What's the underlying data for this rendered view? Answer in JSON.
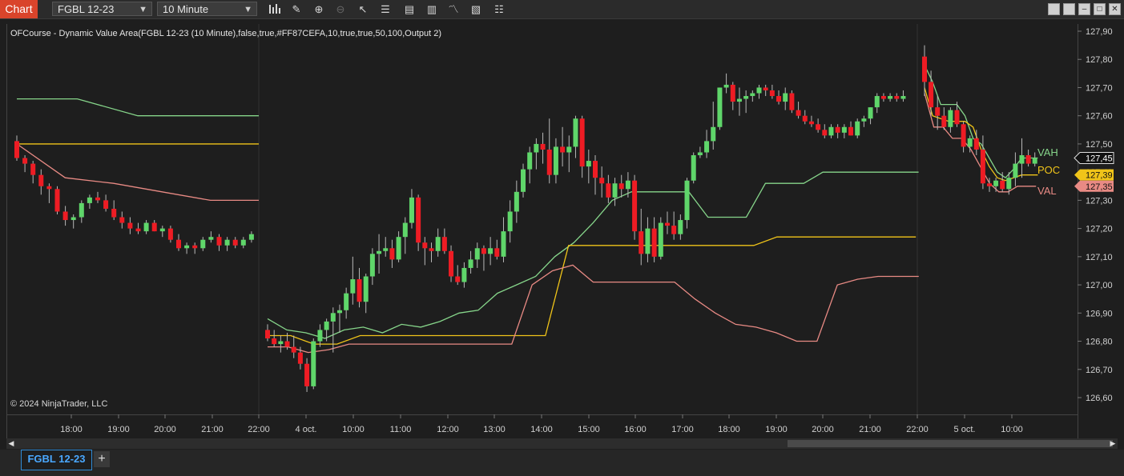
{
  "title_tag": "Chart",
  "instrument": "FGBL 12-23",
  "interval": "10 Minute",
  "indicator_label": "OFCourse - Dynamic Value Area(FGBL 12-23 (10 Minute),false,true,#FF87CEFA,10,true,true,50,100,Output 2)",
  "copyright": "© 2024 NinjaTrader, LLC",
  "tab_label": "FGBL 12-23",
  "add_tab": "+",
  "colors": {
    "up": "#5fd66a",
    "down": "#ee1c24",
    "vah": "#86d58a",
    "poc": "#f0c419",
    "val": "#e88a84",
    "axis_text": "#d0d0d0"
  },
  "chart_data": {
    "type": "candlestick",
    "y_ticks": [
      "127,90",
      "127,80",
      "127,70",
      "127,60",
      "127,50",
      "127,40",
      "127,30",
      "127,20",
      "127,10",
      "127,00",
      "126,90",
      "126,80",
      "126,70",
      "126,60"
    ],
    "ylim": [
      126.56,
      127.93
    ],
    "x_ticks": [
      "18:00",
      "19:00",
      "20:00",
      "21:00",
      "22:00",
      "4 oct.",
      "10:00",
      "11:00",
      "12:00",
      "13:00",
      "14:00",
      "15:00",
      "16:00",
      "17:00",
      "18:00",
      "19:00",
      "20:00",
      "21:00",
      "22:00",
      "5 oct.",
      "10:00"
    ],
    "price_labels": [
      {
        "text": "127,45",
        "value": 127.45,
        "kind": "last"
      },
      {
        "text": "127,39",
        "value": 127.39,
        "kind": "poc"
      },
      {
        "text": "127,35",
        "value": 127.35,
        "kind": "val"
      }
    ],
    "line_labels": [
      {
        "text": "VAH",
        "kind": "vah"
      },
      {
        "text": "POC",
        "kind": "poc"
      },
      {
        "text": "VAL",
        "kind": "val"
      }
    ],
    "session1": {
      "candles": [
        [
          127.51,
          127.53,
          127.44,
          127.45
        ],
        [
          127.45,
          127.46,
          127.4,
          127.43
        ],
        [
          127.43,
          127.44,
          127.36,
          127.39
        ],
        [
          127.39,
          127.41,
          127.32,
          127.35
        ],
        [
          127.35,
          127.36,
          127.29,
          127.34
        ],
        [
          127.34,
          127.35,
          127.25,
          127.26
        ],
        [
          127.26,
          127.28,
          127.21,
          127.23
        ],
        [
          127.23,
          127.25,
          127.2,
          127.24
        ],
        [
          127.24,
          127.3,
          127.22,
          127.29
        ],
        [
          127.29,
          127.32,
          127.27,
          127.31
        ],
        [
          127.31,
          127.33,
          127.29,
          127.3
        ],
        [
          127.3,
          127.32,
          127.26,
          127.27
        ],
        [
          127.27,
          127.3,
          127.23,
          127.24
        ],
        [
          127.24,
          127.26,
          127.2,
          127.22
        ],
        [
          127.22,
          127.24,
          127.18,
          127.2
        ],
        [
          127.2,
          127.22,
          127.18,
          127.19
        ],
        [
          127.19,
          127.23,
          127.18,
          127.22
        ],
        [
          127.22,
          127.23,
          127.19,
          127.19
        ],
        [
          127.19,
          127.21,
          127.17,
          127.2
        ],
        [
          127.2,
          127.21,
          127.15,
          127.16
        ],
        [
          127.16,
          127.18,
          127.12,
          127.13
        ],
        [
          127.13,
          127.15,
          127.11,
          127.14
        ],
        [
          127.14,
          127.15,
          127.11,
          127.13
        ],
        [
          127.13,
          127.17,
          127.12,
          127.16
        ],
        [
          127.16,
          127.19,
          127.15,
          127.17
        ],
        [
          127.17,
          127.18,
          127.12,
          127.14
        ],
        [
          127.14,
          127.17,
          127.12,
          127.16
        ],
        [
          127.16,
          127.17,
          127.13,
          127.14
        ],
        [
          127.14,
          127.17,
          127.13,
          127.16
        ],
        [
          127.16,
          127.19,
          127.15,
          127.18
        ]
      ],
      "vah": [
        127.66,
        127.66,
        127.6,
        127.6,
        127.6
      ],
      "poc": [
        127.5,
        127.5,
        127.5
      ],
      "val": [
        127.5,
        127.38,
        127.36,
        127.33,
        127.3,
        127.3
      ]
    },
    "session2": {
      "candles": [
        [
          126.84,
          126.86,
          126.8,
          126.81
        ],
        [
          126.81,
          126.84,
          126.78,
          126.79
        ],
        [
          126.79,
          126.82,
          126.76,
          126.8
        ],
        [
          126.8,
          126.83,
          126.77,
          126.78
        ],
        [
          126.78,
          126.82,
          126.74,
          126.76
        ],
        [
          126.76,
          126.78,
          126.7,
          126.72
        ],
        [
          126.72,
          126.74,
          126.62,
          126.64
        ],
        [
          126.64,
          126.81,
          126.63,
          126.8
        ],
        [
          126.8,
          126.86,
          126.78,
          126.84
        ],
        [
          126.84,
          126.88,
          126.8,
          126.87
        ],
        [
          126.87,
          126.92,
          126.76,
          126.9
        ],
        [
          126.9,
          126.93,
          126.83,
          126.91
        ],
        [
          126.91,
          126.99,
          126.88,
          126.97
        ],
        [
          126.97,
          127.1,
          126.93,
          127.02
        ],
        [
          127.02,
          127.06,
          126.92,
          126.94
        ],
        [
          126.94,
          127.04,
          126.9,
          127.03
        ],
        [
          127.03,
          127.13,
          127.0,
          127.11
        ],
        [
          127.11,
          127.18,
          127.04,
          127.12
        ],
        [
          127.12,
          127.17,
          127.1,
          127.13
        ],
        [
          127.13,
          127.16,
          127.06,
          127.09
        ],
        [
          127.09,
          127.19,
          127.08,
          127.17
        ],
        [
          127.17,
          127.24,
          127.11,
          127.22
        ],
        [
          127.22,
          127.34,
          127.2,
          127.31
        ],
        [
          127.31,
          127.32,
          127.12,
          127.15
        ],
        [
          127.15,
          127.17,
          127.07,
          127.13
        ],
        [
          127.13,
          127.15,
          127.08,
          127.12
        ],
        [
          127.12,
          127.2,
          127.1,
          127.17
        ],
        [
          127.17,
          127.2,
          127.11,
          127.12
        ],
        [
          127.12,
          127.14,
          127.01,
          127.03
        ],
        [
          127.03,
          127.07,
          127.0,
          127.01
        ],
        [
          127.01,
          127.08,
          126.99,
          127.06
        ],
        [
          127.06,
          127.12,
          127.04,
          127.09
        ],
        [
          127.09,
          127.15,
          127.06,
          127.13
        ],
        [
          127.13,
          127.14,
          127.05,
          127.11
        ],
        [
          127.11,
          127.17,
          127.07,
          127.13
        ],
        [
          127.13,
          127.16,
          127.09,
          127.1
        ],
        [
          127.1,
          127.24,
          127.08,
          127.19
        ],
        [
          127.19,
          127.3,
          127.15,
          127.26
        ],
        [
          127.26,
          127.37,
          127.22,
          127.33
        ],
        [
          127.33,
          127.43,
          127.31,
          127.41
        ],
        [
          127.41,
          127.49,
          127.36,
          127.47
        ],
        [
          127.47,
          127.52,
          127.41,
          127.5
        ],
        [
          127.5,
          127.54,
          127.43,
          127.48
        ],
        [
          127.48,
          127.59,
          127.36,
          127.39
        ],
        [
          127.39,
          127.52,
          127.36,
          127.49
        ],
        [
          127.49,
          127.56,
          127.42,
          127.47
        ],
        [
          127.47,
          127.53,
          127.4,
          127.49
        ],
        [
          127.49,
          127.6,
          127.45,
          127.59
        ],
        [
          127.59,
          127.6,
          127.38,
          127.42
        ],
        [
          127.42,
          127.48,
          127.36,
          127.44
        ],
        [
          127.44,
          127.46,
          127.32,
          127.38
        ],
        [
          127.38,
          127.42,
          127.31,
          127.36
        ],
        [
          127.36,
          127.39,
          127.29,
          127.31
        ],
        [
          127.31,
          127.38,
          127.28,
          127.36
        ],
        [
          127.36,
          127.39,
          127.31,
          127.34
        ],
        [
          127.34,
          127.4,
          127.31,
          127.37
        ],
        [
          127.37,
          127.39,
          127.16,
          127.19
        ],
        [
          127.19,
          127.27,
          127.07,
          127.11
        ],
        [
          127.11,
          127.24,
          127.08,
          127.2
        ],
        [
          127.2,
          127.24,
          127.08,
          127.1
        ],
        [
          127.1,
          127.24,
          127.09,
          127.22
        ],
        [
          127.22,
          127.26,
          127.18,
          127.21
        ],
        [
          127.21,
          127.26,
          127.16,
          127.18
        ],
        [
          127.18,
          127.25,
          127.16,
          127.23
        ],
        [
          127.23,
          127.38,
          127.2,
          127.37
        ],
        [
          127.37,
          127.47,
          127.36,
          127.46
        ],
        [
          127.46,
          127.49,
          127.45,
          127.47
        ],
        [
          127.47,
          127.55,
          127.45,
          127.51
        ],
        [
          127.51,
          127.65,
          127.48,
          127.56
        ],
        [
          127.56,
          127.7,
          127.55,
          127.7
        ],
        [
          127.7,
          127.75,
          127.68,
          127.71
        ],
        [
          127.71,
          127.72,
          127.62,
          127.65
        ],
        [
          127.65,
          127.7,
          127.6,
          127.66
        ],
        [
          127.66,
          127.69,
          127.61,
          127.67
        ],
        [
          127.67,
          127.69,
          127.65,
          127.68
        ],
        [
          127.68,
          127.71,
          127.66,
          127.7
        ],
        [
          127.7,
          127.71,
          127.67,
          127.69
        ],
        [
          127.69,
          127.71,
          127.66,
          127.67
        ],
        [
          127.67,
          127.69,
          127.64,
          127.65
        ],
        [
          127.65,
          127.7,
          127.62,
          127.68
        ],
        [
          127.68,
          127.69,
          127.61,
          127.62
        ],
        [
          127.62,
          127.65,
          127.59,
          127.6
        ],
        [
          127.6,
          127.62,
          127.57,
          127.58
        ],
        [
          127.58,
          127.6,
          127.56,
          127.57
        ],
        [
          127.57,
          127.59,
          127.54,
          127.55
        ],
        [
          127.55,
          127.57,
          127.52,
          127.53
        ],
        [
          127.53,
          127.57,
          127.52,
          127.56
        ],
        [
          127.56,
          127.57,
          127.52,
          127.54
        ],
        [
          127.54,
          127.57,
          127.52,
          127.56
        ],
        [
          127.56,
          127.58,
          127.53,
          127.53
        ],
        [
          127.53,
          127.59,
          127.52,
          127.58
        ],
        [
          127.58,
          127.6,
          127.56,
          127.59
        ],
        [
          127.59,
          127.63,
          127.57,
          127.63
        ],
        [
          127.63,
          127.68,
          127.61,
          127.67
        ],
        [
          127.67,
          127.68,
          127.65,
          127.66
        ],
        [
          127.66,
          127.68,
          127.65,
          127.67
        ],
        [
          127.67,
          127.68,
          127.65,
          127.66
        ],
        [
          127.66,
          127.69,
          127.65,
          127.67
        ]
      ],
      "vah": [
        126.88,
        126.84,
        126.83,
        126.81,
        126.84,
        126.85,
        126.83,
        126.86,
        126.85,
        126.87,
        126.9,
        126.91,
        126.97,
        127.0,
        127.03,
        127.1,
        127.15,
        127.22,
        127.3,
        127.33,
        127.33,
        127.33,
        127.33,
        127.24,
        127.24,
        127.24,
        127.36,
        127.36,
        127.36,
        127.4,
        127.4,
        127.4,
        127.4,
        127.4,
        127.4
      ],
      "poc": [
        126.82,
        126.82,
        126.79,
        126.79,
        126.82,
        126.82,
        126.82,
        126.82,
        126.82,
        126.82,
        126.82,
        126.82,
        126.82,
        127.14,
        127.14,
        127.14,
        127.14,
        127.14,
        127.14,
        127.14,
        127.14,
        127.14,
        127.17,
        127.17,
        127.17,
        127.17,
        127.17,
        127.17,
        127.17
      ],
      "val": [
        126.78,
        126.78,
        126.76,
        126.77,
        126.79,
        126.79,
        126.79,
        126.79,
        126.79,
        126.79,
        126.79,
        126.79,
        126.79,
        127.0,
        127.05,
        127.07,
        127.01,
        127.01,
        127.01,
        127.01,
        127.01,
        126.95,
        126.9,
        126.86,
        126.85,
        126.83,
        126.8,
        126.8,
        127.0,
        127.02,
        127.03,
        127.03,
        127.03
      ]
    },
    "session3": {
      "candles": [
        [
          127.81,
          127.85,
          127.67,
          127.72
        ],
        [
          127.72,
          127.76,
          127.6,
          127.63
        ],
        [
          127.63,
          127.67,
          127.55,
          127.6
        ],
        [
          127.6,
          127.63,
          127.55,
          127.56
        ],
        [
          127.56,
          127.63,
          127.54,
          127.62
        ],
        [
          127.62,
          127.65,
          127.56,
          127.57
        ],
        [
          127.57,
          127.58,
          127.47,
          127.49
        ],
        [
          127.49,
          127.53,
          127.47,
          127.52
        ],
        [
          127.52,
          127.55,
          127.46,
          127.48
        ],
        [
          127.48,
          127.53,
          127.34,
          127.36
        ],
        [
          127.36,
          127.38,
          127.33,
          127.35
        ],
        [
          127.35,
          127.38,
          127.33,
          127.37
        ],
        [
          127.37,
          127.4,
          127.33,
          127.34
        ],
        [
          127.34,
          127.4,
          127.32,
          127.38
        ],
        [
          127.38,
          127.47,
          127.35,
          127.43
        ],
        [
          127.43,
          127.52,
          127.38,
          127.46
        ],
        [
          127.46,
          127.48,
          127.42,
          127.43
        ],
        [
          127.43,
          127.47,
          127.42,
          127.45
        ]
      ],
      "vah": [
        127.78,
        127.72,
        127.64,
        127.64,
        127.64,
        127.6,
        127.52,
        127.5,
        127.45,
        127.4,
        127.38,
        127.41,
        127.45,
        127.45,
        127.45
      ],
      "poc": [
        127.7,
        127.6,
        127.59,
        127.58,
        127.58,
        127.58,
        127.56,
        127.48,
        127.42,
        127.38,
        127.37,
        127.38,
        127.39,
        127.39,
        127.39
      ],
      "val": [
        127.68,
        127.56,
        127.56,
        127.52,
        127.52,
        127.48,
        127.42,
        127.36,
        127.33,
        127.33,
        127.35,
        127.35,
        127.35
      ]
    }
  }
}
